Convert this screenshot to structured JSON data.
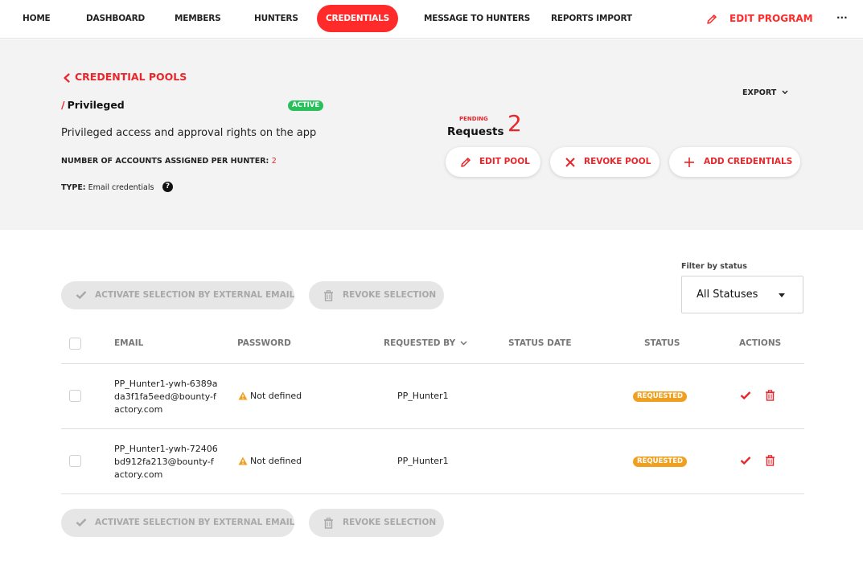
{
  "nav": {
    "items": [
      {
        "label": "HOME"
      },
      {
        "label": "DASHBOARD"
      },
      {
        "label": "MEMBERS"
      },
      {
        "label": "HUNTERS"
      },
      {
        "label": "CREDENTIALS"
      },
      {
        "label": "MESSAGE TO HUNTERS"
      },
      {
        "label": "REPORTS IMPORT"
      }
    ],
    "active": "CREDENTIALS",
    "edit_program": "EDIT PROGRAM",
    "more": "..."
  },
  "header": {
    "back_label": "CREDENTIAL POOLS",
    "slash": "/",
    "pool_name": "Privileged",
    "pool_status": "ACTIVE",
    "description": "Privileged access and approval rights on the app",
    "accounts_label": "NUMBER OF ACCOUNTS ASSIGNED PER HUNTER:",
    "accounts_value": "2",
    "type_label": "TYPE:",
    "type_value": "Email credentials",
    "help": "?",
    "export_label": "EXPORT",
    "pending_label": "PENDING",
    "requests_label": "Requests",
    "requests_count": "2",
    "buttons": {
      "edit_pool": "EDIT POOL",
      "revoke_pool": "REVOKE POOL",
      "add_credentials": "ADD CREDENTIALS"
    }
  },
  "bulk": {
    "activate_label": "ACTIVATE SELECTION BY EXTERNAL EMAIL",
    "revoke_label": "REVOKE SELECTION"
  },
  "filter": {
    "label": "Filter by status",
    "value": "All Statuses"
  },
  "table": {
    "columns": {
      "email": "EMAIL",
      "password": "PASSWORD",
      "requested_by": "REQUESTED BY",
      "status_date": "STATUS DATE",
      "status": "STATUS",
      "actions": "ACTIONS"
    },
    "rows": [
      {
        "email": "PP_Hunter1-ywh-6389ada3f1fa5eed@bounty-factory.com",
        "password": "Not defined",
        "requested_by": "PP_Hunter1",
        "status_date": "",
        "status": "REQUESTED"
      },
      {
        "email": "PP_Hunter1-ywh-72406bd912fa213@bounty-factory.com",
        "password": "Not defined",
        "requested_by": "PP_Hunter1",
        "status_date": "",
        "status": "REQUESTED"
      }
    ]
  },
  "colors": {
    "accent": "#ff2a2a",
    "active": "#27c05a",
    "requested": "#f0a020"
  }
}
